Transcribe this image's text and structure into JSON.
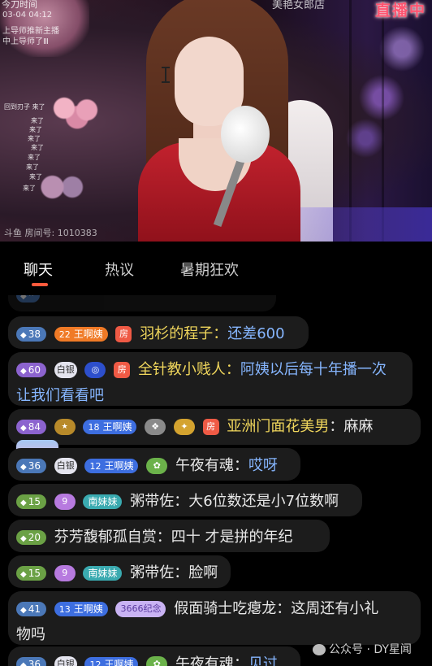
{
  "video": {
    "time": "今刀时间",
    "date": "03-04 04:12",
    "lines": [
      "上导师推新主播",
      "中上导师了Ⅲ"
    ],
    "chat_small": [
      "回到刃子 来了",
      "来了",
      "来了",
      "来了",
      "来了",
      "来了",
      "来了",
      "来了",
      "来了"
    ],
    "shop_text": "美艳女郎店",
    "live_badge": "直播中",
    "room_label": "斗鱼  房间号: 1010383"
  },
  "tabs": [
    {
      "label": "聊天",
      "active": true
    },
    {
      "label": "热议",
      "active": false
    },
    {
      "label": "暑期狂欢",
      "active": false
    }
  ],
  "chat": [
    {
      "level": "38",
      "fan_level": "22",
      "fan_name": "王啊姨",
      "badge": "房",
      "user": "羽杉的程子",
      "sep": "：",
      "text": "还差600"
    },
    {
      "level": "60",
      "badge_white": "白银",
      "badge_plat": "",
      "badge": "房",
      "user": "全针教小贱人",
      "sep": "：",
      "text": "阿姨以后每十年播一次",
      "text2": "让我们看看吧"
    },
    {
      "level": "84",
      "badge_gold": "",
      "fan_level": "18",
      "fan_name": "王啊姨",
      "badge": "房",
      "user": "亚洲门面花美男",
      "sep": "：",
      "text": "麻麻"
    },
    {
      "level": "36",
      "badge_white": "白银",
      "fan_level": "12",
      "fan_name": "王啊姨",
      "user": "午夜有魂",
      "sep": "：",
      "text": "哎呀"
    },
    {
      "level": "15",
      "badge_pink": "9",
      "fan_name": "南妹妹",
      "user": "粥带佐",
      "sep": "：",
      "text": "大6位数还是小7位数啊"
    },
    {
      "level": "20",
      "user": "芬芳馥郁孤自赏",
      "sep": "：",
      "text": "四十 才是拼的年纪"
    },
    {
      "level": "15",
      "badge_pink": "9",
      "fan_name": "南妹妹",
      "user": "粥带佐",
      "sep": "：",
      "text": "脸啊"
    },
    {
      "level": "41",
      "fan_level": "13",
      "fan_name": "王啊姨",
      "anniv": "3666纪念",
      "user": "假面骑士吃瘪龙",
      "sep": "：",
      "text": "这周还有小礼",
      "text2": "物吗"
    },
    {
      "level": "36",
      "badge_white": "白银",
      "fan_level": "12",
      "fan_name": "王啊姨",
      "user": "午夜有魂",
      "sep": "：",
      "text": "见过"
    }
  ],
  "watermark": "公众号 · DY星闻",
  "colors": {
    "accent": "#ff5a3c",
    "chat_bg": "#1c1c1c",
    "username_yellow": "#f0d65c",
    "username_blue": "#86b6ff"
  }
}
